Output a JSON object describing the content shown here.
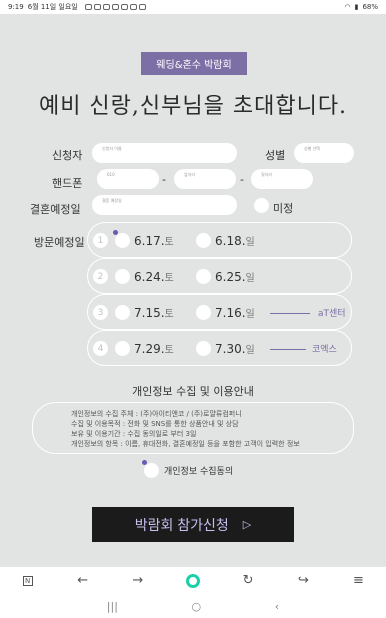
{
  "status": {
    "time": "9:19",
    "date": "6월 11일 일요일",
    "battery": "68%"
  },
  "event": {
    "badge": "웨딩&혼수 박람회",
    "headline": "예비 신랑,신부님을 초대합니다."
  },
  "form": {
    "name_label": "신청자",
    "name_placeholder": "신청자 이름",
    "gender_label": "성별",
    "gender_placeholder": "성별 선택",
    "phone_label": "핸드폰",
    "phone_placeholders": [
      "010",
      "앞자리",
      "뒷자리"
    ],
    "dash": "-",
    "wedding_label": "결혼예정일",
    "wedding_placeholder": "결혼 예정일",
    "undecided": "미정",
    "visit_label": "방문예정일"
  },
  "visit_rows": [
    {
      "num": "1",
      "dates": [
        {
          "day": "6.17.",
          "weekday": "토"
        },
        {
          "day": "6.18.",
          "weekday": "일"
        }
      ],
      "venue": ""
    },
    {
      "num": "2",
      "dates": [
        {
          "day": "6.24.",
          "weekday": "토"
        },
        {
          "day": "6.25.",
          "weekday": "일"
        }
      ],
      "venue": ""
    },
    {
      "num": "3",
      "dates": [
        {
          "day": "7.15.",
          "weekday": "토"
        },
        {
          "day": "7.16.",
          "weekday": "일"
        }
      ],
      "venue": "aT센터"
    },
    {
      "num": "4",
      "dates": [
        {
          "day": "7.29.",
          "weekday": "토"
        },
        {
          "day": "7.30.",
          "weekday": "일"
        }
      ],
      "venue": "코엑스"
    }
  ],
  "privacy": {
    "title": "개인정보 수집 및 이용안내",
    "lines": [
      "개인정보의 수집 주체 : (주)아이티앤코 / (주)로얄류컴퍼니",
      "수집 및 이용목적 : 전화 및 SNS를 통한 상품안내 및 상담",
      "보유 및 이용기간 : 수집 동의일로 부터 3일",
      "개인정보의 항목 : 이름, 휴대전화, 결혼예정일 등을 포함한 고객이 입력한 정보"
    ],
    "agree_label": "개인정보 수집동의"
  },
  "cta": {
    "label": "박람회 참가신청",
    "arrow": "▷"
  },
  "browser_toolbar": {
    "n_label": "N",
    "back": "←",
    "forward": "→",
    "refresh": "↻",
    "share": "↪",
    "menu": "≡"
  },
  "nav_bar": {
    "recents": "|||",
    "home": "○",
    "back": "‹"
  }
}
